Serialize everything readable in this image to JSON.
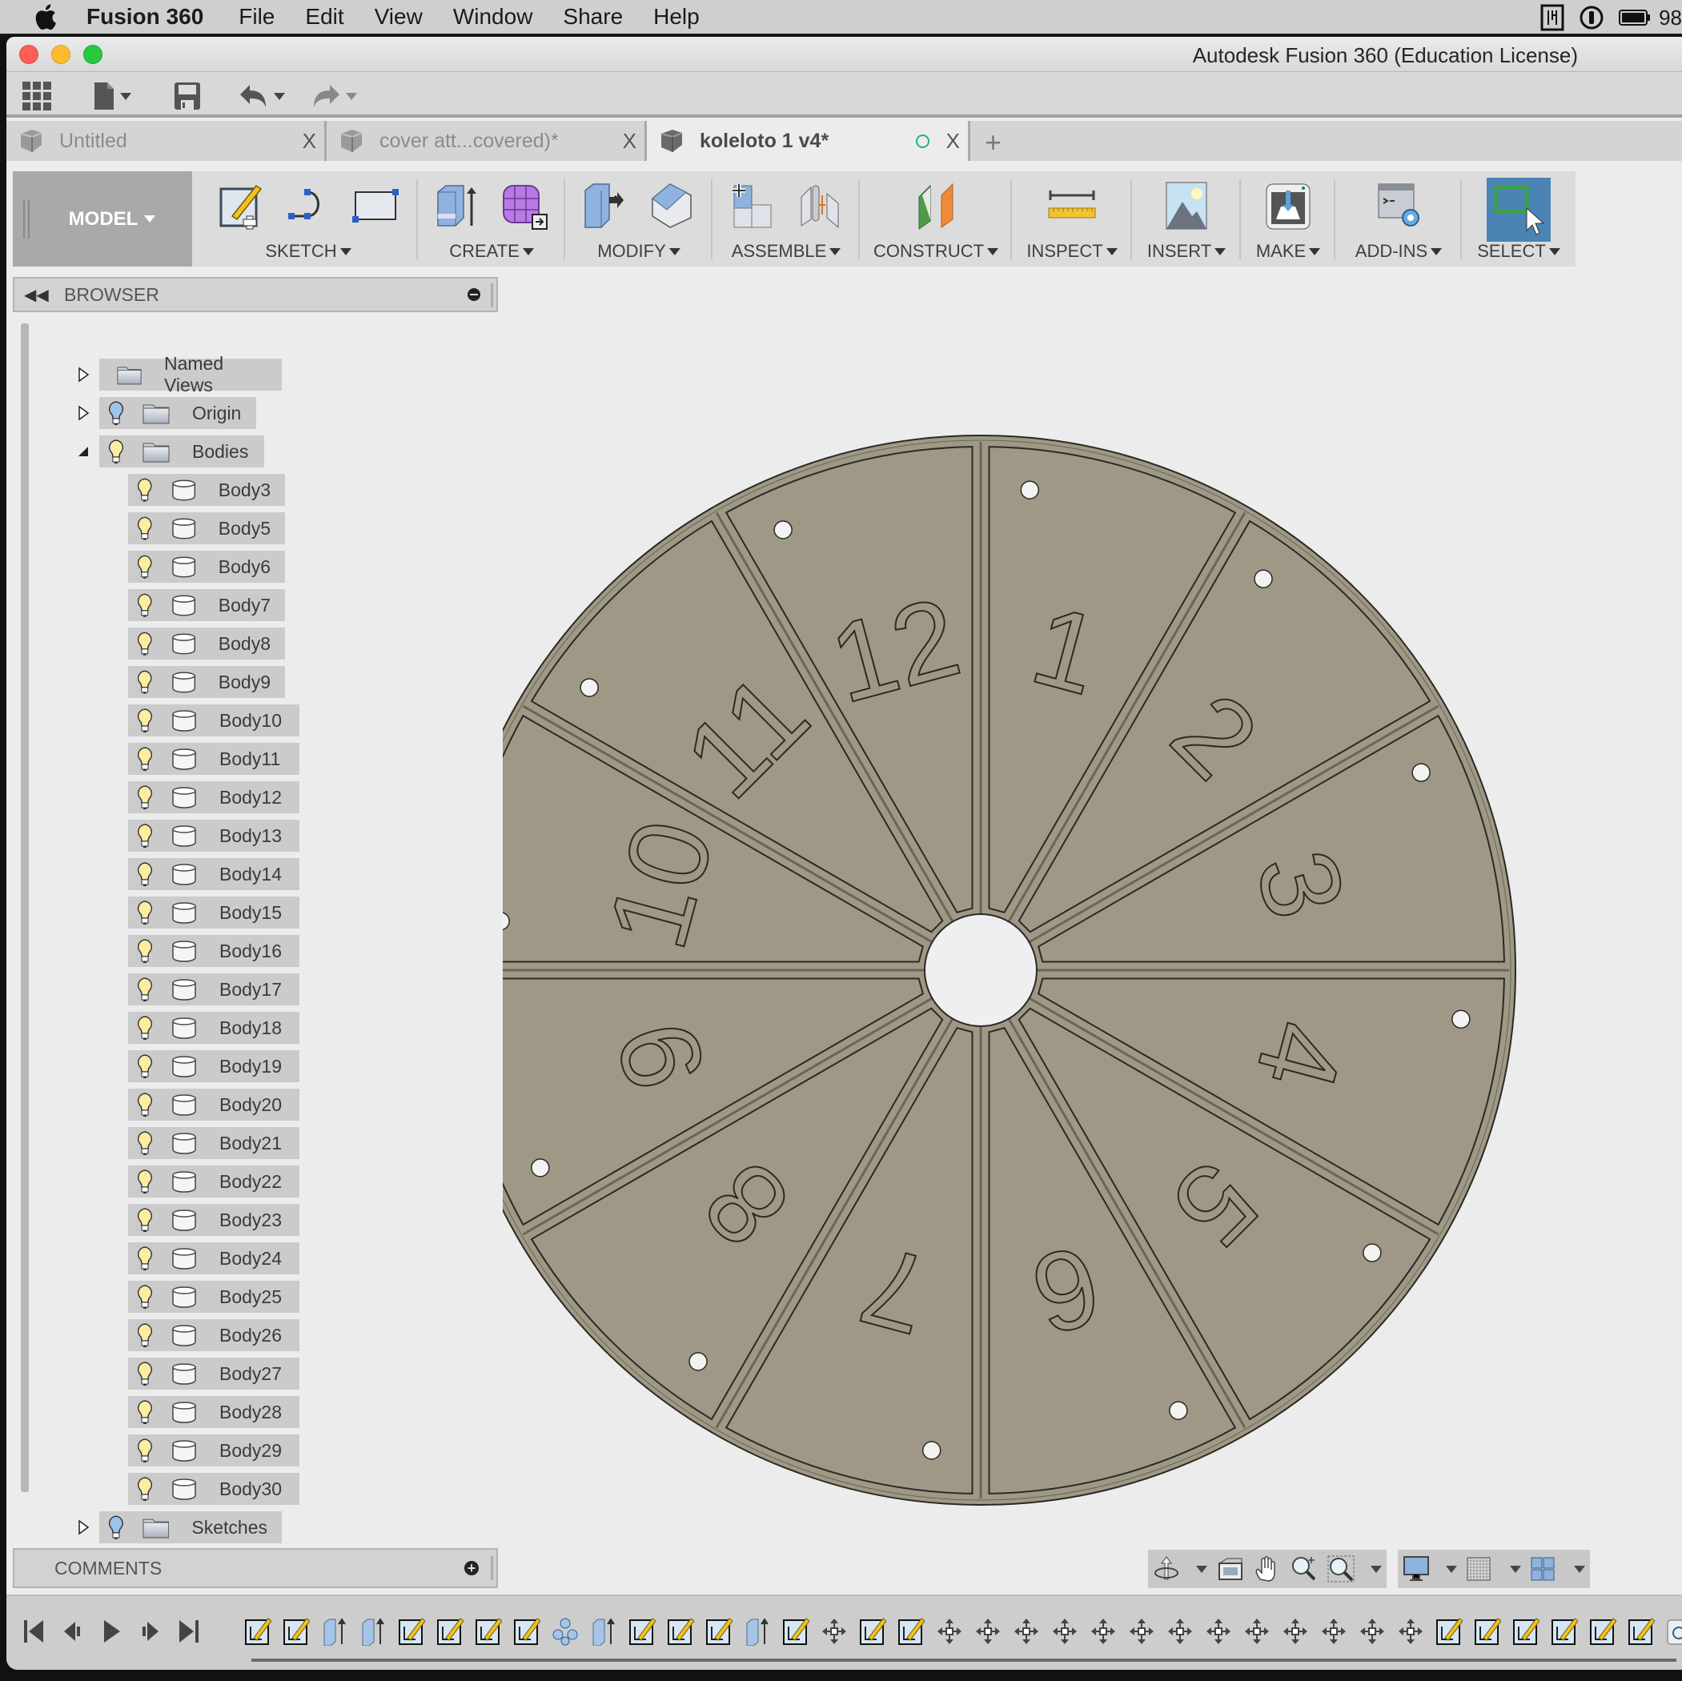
{
  "menubar": {
    "app_name": "Fusion 360",
    "items": [
      "File",
      "Edit",
      "View",
      "Window",
      "Share",
      "Help"
    ],
    "status": {
      "battery_text": "98"
    }
  },
  "window": {
    "title": "Autodesk Fusion 360 (Education License)"
  },
  "quick_access": {
    "icons": [
      "data-panel-icon",
      "file-icon",
      "save-icon",
      "undo-icon",
      "redo-icon"
    ]
  },
  "tabs": [
    {
      "label": "Untitled",
      "active": false
    },
    {
      "label": "cover att...covered)*",
      "active": false
    },
    {
      "label": "koleloto 1 v4*",
      "active": true
    }
  ],
  "tab_close_glyph": "X",
  "new_tab_glyph": "+",
  "ribbon": {
    "workspace": "MODEL",
    "groups": [
      {
        "label": "SKETCH",
        "icons": [
          "create-sketch-icon",
          "arc-icon",
          "rectangle-icon"
        ]
      },
      {
        "label": "CREATE",
        "icons": [
          "extrude-icon",
          "create-form-icon"
        ]
      },
      {
        "label": "MODIFY",
        "icons": [
          "press-pull-icon",
          "fillet-icon"
        ]
      },
      {
        "label": "ASSEMBLE",
        "icons": [
          "new-component-icon",
          "joint-icon"
        ]
      },
      {
        "label": "CONSTRUCT",
        "icons": [
          "offset-plane-icon"
        ]
      },
      {
        "label": "INSPECT",
        "icons": [
          "measure-icon"
        ]
      },
      {
        "label": "INSERT",
        "icons": [
          "insert-image-icon"
        ]
      },
      {
        "label": "MAKE",
        "icons": [
          "3d-print-icon"
        ]
      },
      {
        "label": "ADD-INS",
        "icons": [
          "scripts-addins-icon"
        ]
      },
      {
        "label": "SELECT",
        "icons": [
          "select-icon"
        ]
      }
    ]
  },
  "browser": {
    "title": "BROWSER",
    "folders": [
      {
        "label": "Named Views",
        "expanded": false,
        "has_bulb": false
      },
      {
        "label": "Origin",
        "expanded": false,
        "has_bulb": true,
        "bulb": "off"
      },
      {
        "label": "Bodies",
        "expanded": true,
        "has_bulb": true,
        "bulb": "on"
      }
    ],
    "bodies": [
      "Body3",
      "Body5",
      "Body6",
      "Body7",
      "Body8",
      "Body9",
      "Body10",
      "Body11",
      "Body12",
      "Body13",
      "Body14",
      "Body15",
      "Body16",
      "Body17",
      "Body18",
      "Body19",
      "Body20",
      "Body21",
      "Body22",
      "Body23",
      "Body24",
      "Body25",
      "Body26",
      "Body27",
      "Body28",
      "Body29",
      "Body30"
    ],
    "sketches": {
      "label": "Sketches",
      "expanded": false,
      "bulb": "off"
    }
  },
  "comments": {
    "title": "COMMENTS"
  },
  "model": {
    "type": "numbered disc",
    "segments": 12,
    "numbers": [
      "12",
      "1",
      "2",
      "3",
      "4",
      "5",
      "6",
      "7",
      "8",
      "9",
      "10",
      "11"
    ],
    "colors": {
      "face": "#9f9886",
      "edge": "#2a2a22",
      "background": "#ececec"
    }
  },
  "navbar": {
    "group1": [
      "orbit-icon",
      "look-at-icon",
      "pan-icon",
      "zoom-icon",
      "fit-icon"
    ],
    "group2": [
      "display-settings-icon",
      "grid-icon",
      "viewports-icon"
    ]
  },
  "timeline": {
    "controls": [
      "go-to-start",
      "step-back",
      "play",
      "step-forward",
      "go-to-end"
    ],
    "features": [
      "sketch",
      "sketch",
      "extrude",
      "extrude",
      "sketch",
      "sketch",
      "sketch",
      "sketch",
      "circular-pattern",
      "extrude",
      "sketch",
      "sketch",
      "sketch",
      "extrude",
      "sketch",
      "move",
      "sketch",
      "sketch",
      "move",
      "move",
      "move",
      "move",
      "move",
      "move",
      "move",
      "move",
      "move",
      "move",
      "move",
      "move",
      "move",
      "sketch",
      "sketch",
      "sketch",
      "sketch",
      "sketch",
      "sketch",
      "combine"
    ]
  },
  "colors": {
    "select_active": "#4a83b4",
    "saved_indicator": "#20b487"
  }
}
